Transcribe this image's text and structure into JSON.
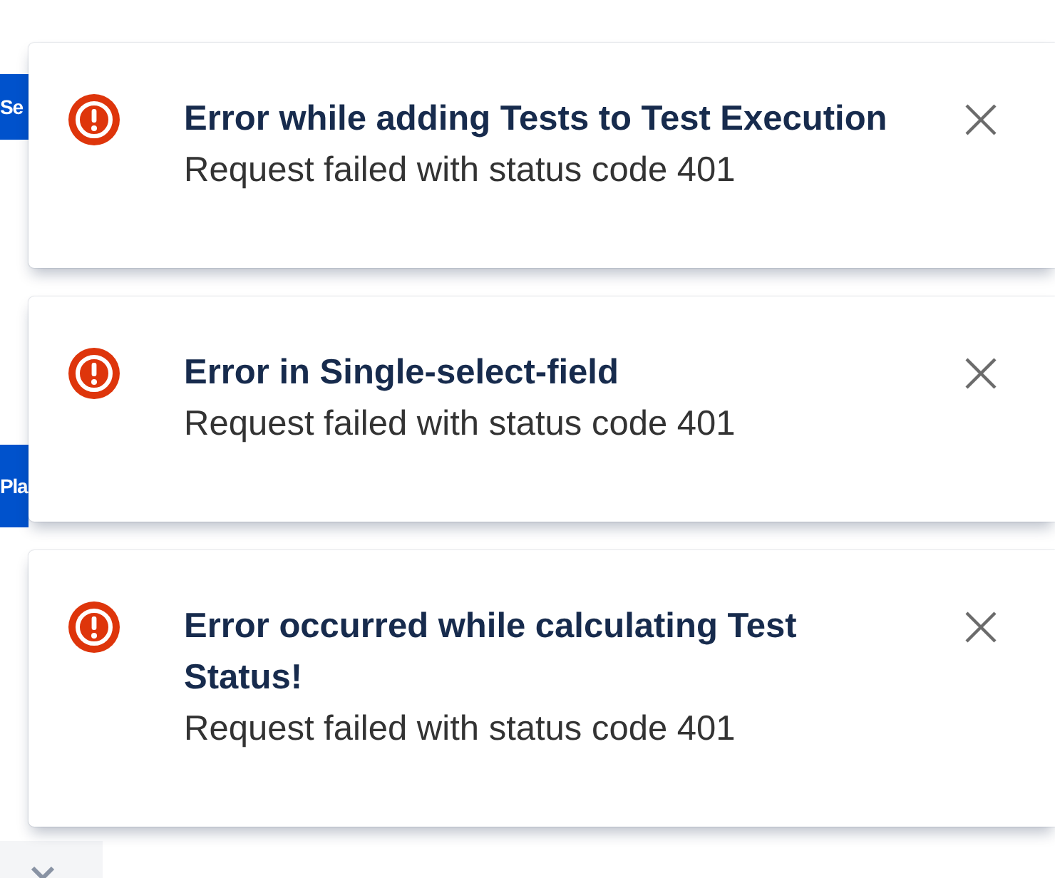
{
  "background": {
    "buttons": [
      {
        "label": "Se"
      },
      {
        "label": "Pla"
      }
    ]
  },
  "flags": [
    {
      "title": "Error while adding Tests to Test Execution",
      "description": "Request failed with status code 401"
    },
    {
      "title": "Error in Single-select-field",
      "description": "Request failed with status code 401"
    },
    {
      "title": "Error occurred while calculating Test Status!",
      "description": "Request failed with status code 401"
    }
  ]
}
